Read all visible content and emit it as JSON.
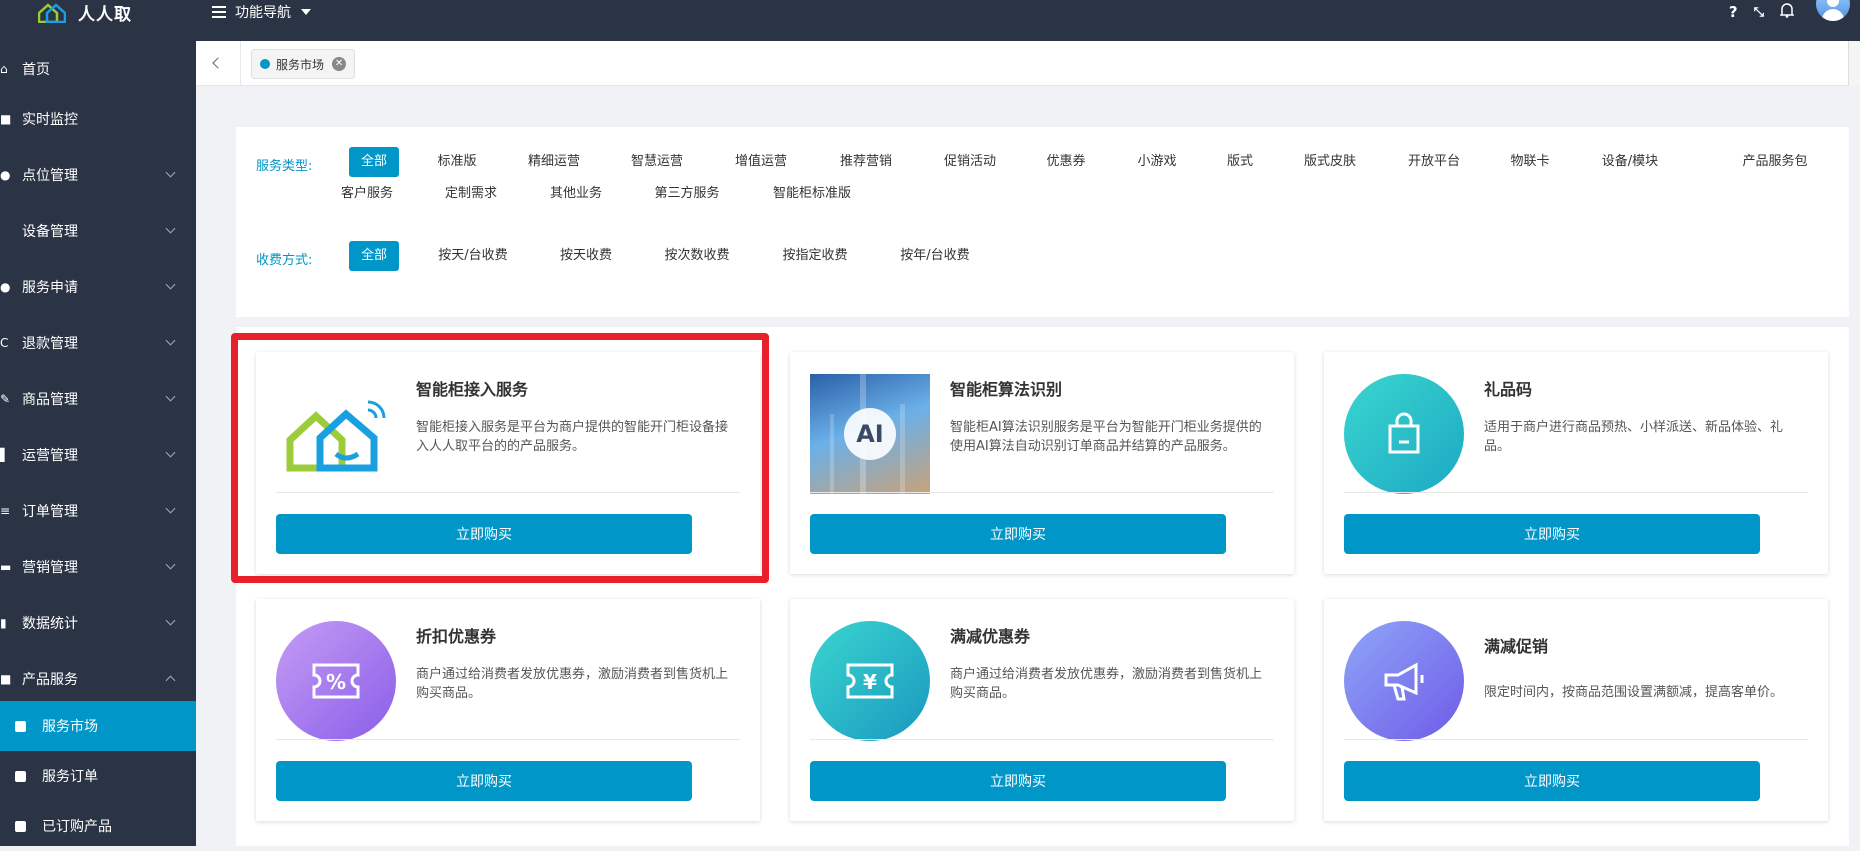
{
  "app": {
    "name": "人人取"
  },
  "topbar": {
    "nav_label": "功能导航",
    "icons": [
      "question-icon",
      "fullscreen-icon",
      "bell-icon",
      "avatar"
    ]
  },
  "sidebar": {
    "items": [
      {
        "label": "首页",
        "icon": "home-icon"
      },
      {
        "label": "实时监控",
        "icon": "camera-icon"
      },
      {
        "label": "点位管理",
        "icon": "pin-icon"
      },
      {
        "label": "设备管理",
        "icon": "device-icon"
      },
      {
        "label": "服务申请",
        "icon": "user-icon"
      },
      {
        "label": "退款管理",
        "icon": "refund-icon"
      },
      {
        "label": "商品管理",
        "icon": "edit-icon"
      },
      {
        "label": "运营管理",
        "icon": "flag-icon"
      },
      {
        "label": "订单管理",
        "icon": "list-icon"
      },
      {
        "label": "营销管理",
        "icon": "shop-icon"
      },
      {
        "label": "数据统计",
        "icon": "chart-icon"
      },
      {
        "label": "产品服务",
        "icon": "box-icon"
      }
    ],
    "sub_items": [
      {
        "label": "服务市场",
        "active": true
      },
      {
        "label": "服务订单",
        "active": false
      },
      {
        "label": "已订购产品",
        "active": false
      }
    ]
  },
  "tabs": [
    {
      "label": "服务市场"
    }
  ],
  "filters": {
    "type_label": "服务类型:",
    "type_options": [
      "全部",
      "标准版",
      "精细运营",
      "智慧运营",
      "增值运营",
      "推荐营销",
      "促销活动",
      "优惠券",
      "小游戏",
      "版式",
      "版式皮肤",
      "开放平台",
      "物联卡",
      "设备/模块",
      "产品服务包",
      "客户服务",
      "定制需求",
      "其他业务",
      "第三方服务",
      "智能柜标准版"
    ],
    "type_selected": "全部",
    "fee_label": "收费方式:",
    "fee_options": [
      "全部",
      "按天/台收费",
      "按天收费",
      "按次数收费",
      "按指定收费",
      "按年/台收费"
    ],
    "fee_selected": "全部"
  },
  "cards": [
    {
      "title": "智能柜接入服务",
      "desc": "智能柜接入服务是平台为商户提供的智能开门柜设备接入人人取平台的的产品服务。",
      "button": "立即购买",
      "image": "house-logo",
      "highlighted": true
    },
    {
      "title": "智能柜算法识别",
      "desc": "智能柜AI算法识别服务是平台为智能开门柜业务提供的使用AI算法自动识别订单商品并结算的产品服务。",
      "button": "立即购买",
      "image": "ai-photo",
      "badge": "AI"
    },
    {
      "title": "礼品码",
      "desc": "适用于商户进行商品预热、小样派送、新品体验、礼品。",
      "button": "立即购买",
      "image": "bag-icon",
      "color": "#2bbfc9"
    },
    {
      "title": "折扣优惠券",
      "desc": "商户通过给消费者发放优惠券，激励消费者到售货机上购买商品。",
      "button": "立即购买",
      "image": "percent-ticket-icon",
      "color": "#a07bf0"
    },
    {
      "title": "满减优惠券",
      "desc": "商户通过给消费者发放优惠券，激励消费者到售货机上购买商品。",
      "button": "立即购买",
      "image": "yen-ticket-icon",
      "color": "#2ab8c8"
    },
    {
      "title": "满减促销",
      "desc": "限定时间内，按商品范围设置满额减，提高客单价。",
      "button": "立即购买",
      "image": "megaphone-icon",
      "color": "#7b7cf0"
    }
  ]
}
